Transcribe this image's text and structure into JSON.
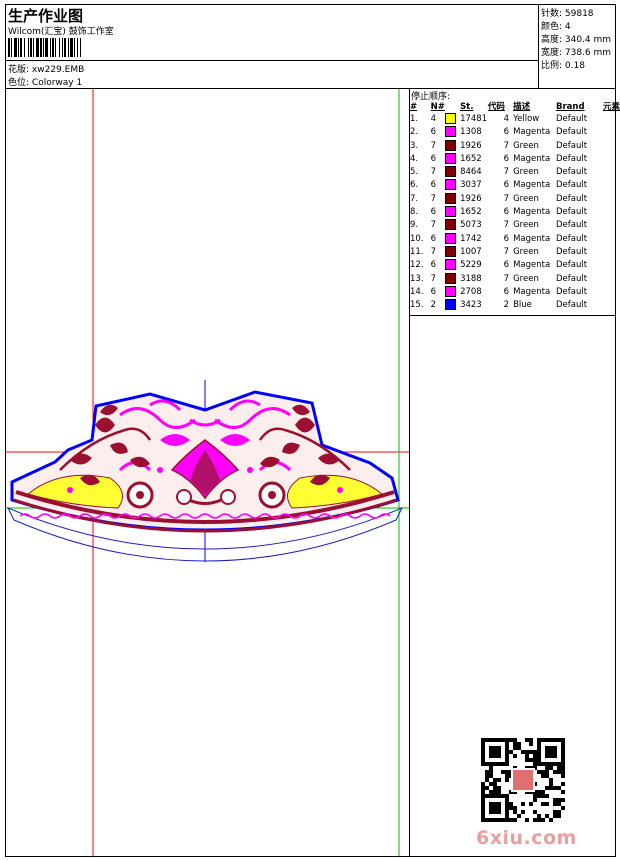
{
  "header": {
    "title": "生产作业图",
    "company": "Wilcom(汇宝) 鼓饰工作室",
    "design_label": "花版:",
    "design_value": "xw229.EMB",
    "colorway_label": "色位:",
    "colorway_value": "Colorway 1"
  },
  "stats": {
    "stitches": "针数: 59818",
    "colors": "颜色: 4",
    "height": "高度: 340.4 mm",
    "width": "宽度: 738.6 mm",
    "scale": "比例: 0.18"
  },
  "color_sequence": {
    "title": "停止顺序:",
    "headers": [
      "#",
      "N#",
      "St.",
      "代码",
      "描述",
      "Brand",
      "元素"
    ],
    "rows": [
      {
        "idx": "1.",
        "needle": "4",
        "color": "#ffff00",
        "stitches": "17481",
        "code": "4",
        "desc": "Yellow",
        "brand": "Default"
      },
      {
        "idx": "2.",
        "needle": "6",
        "color": "#ff00ff",
        "stitches": "1308",
        "code": "6",
        "desc": "Magenta",
        "brand": "Default"
      },
      {
        "idx": "3.",
        "needle": "7",
        "color": "#800000",
        "stitches": "1926",
        "code": "7",
        "desc": "Green",
        "brand": "Default"
      },
      {
        "idx": "4.",
        "needle": "6",
        "color": "#ff00ff",
        "stitches": "1652",
        "code": "6",
        "desc": "Magenta",
        "brand": "Default"
      },
      {
        "idx": "5.",
        "needle": "7",
        "color": "#800000",
        "stitches": "8464",
        "code": "7",
        "desc": "Green",
        "brand": "Default"
      },
      {
        "idx": "6.",
        "needle": "6",
        "color": "#ff00ff",
        "stitches": "3037",
        "code": "6",
        "desc": "Magenta",
        "brand": "Default"
      },
      {
        "idx": "7.",
        "needle": "7",
        "color": "#800000",
        "stitches": "1926",
        "code": "7",
        "desc": "Green",
        "brand": "Default"
      },
      {
        "idx": "8.",
        "needle": "6",
        "color": "#ff00ff",
        "stitches": "1652",
        "code": "6",
        "desc": "Magenta",
        "brand": "Default"
      },
      {
        "idx": "9.",
        "needle": "7",
        "color": "#800000",
        "stitches": "5073",
        "code": "7",
        "desc": "Green",
        "brand": "Default"
      },
      {
        "idx": "10.",
        "needle": "6",
        "color": "#ff00ff",
        "stitches": "1742",
        "code": "6",
        "desc": "Magenta",
        "brand": "Default"
      },
      {
        "idx": "11.",
        "needle": "7",
        "color": "#800000",
        "stitches": "1007",
        "code": "7",
        "desc": "Green",
        "brand": "Default"
      },
      {
        "idx": "12.",
        "needle": "6",
        "color": "#ff00ff",
        "stitches": "5229",
        "code": "6",
        "desc": "Magenta",
        "brand": "Default"
      },
      {
        "idx": "13.",
        "needle": "7",
        "color": "#800000",
        "stitches": "3188",
        "code": "7",
        "desc": "Green",
        "brand": "Default"
      },
      {
        "idx": "14.",
        "needle": "6",
        "color": "#ff00ff",
        "stitches": "2708",
        "code": "6",
        "desc": "Magenta",
        "brand": "Default"
      },
      {
        "idx": "15.",
        "needle": "2",
        "color": "#0000ff",
        "stitches": "3423",
        "code": "2",
        "desc": "Blue",
        "brand": "Default"
      }
    ]
  },
  "watermark": {
    "site": "6xiu.com"
  },
  "colors": {
    "guide_red": "#ff0000",
    "guide_green": "#00c000",
    "outline_blue": "#0000ff",
    "maroon": "#9b1030",
    "magenta": "#ff00ff",
    "yellow": "#ffff00"
  }
}
